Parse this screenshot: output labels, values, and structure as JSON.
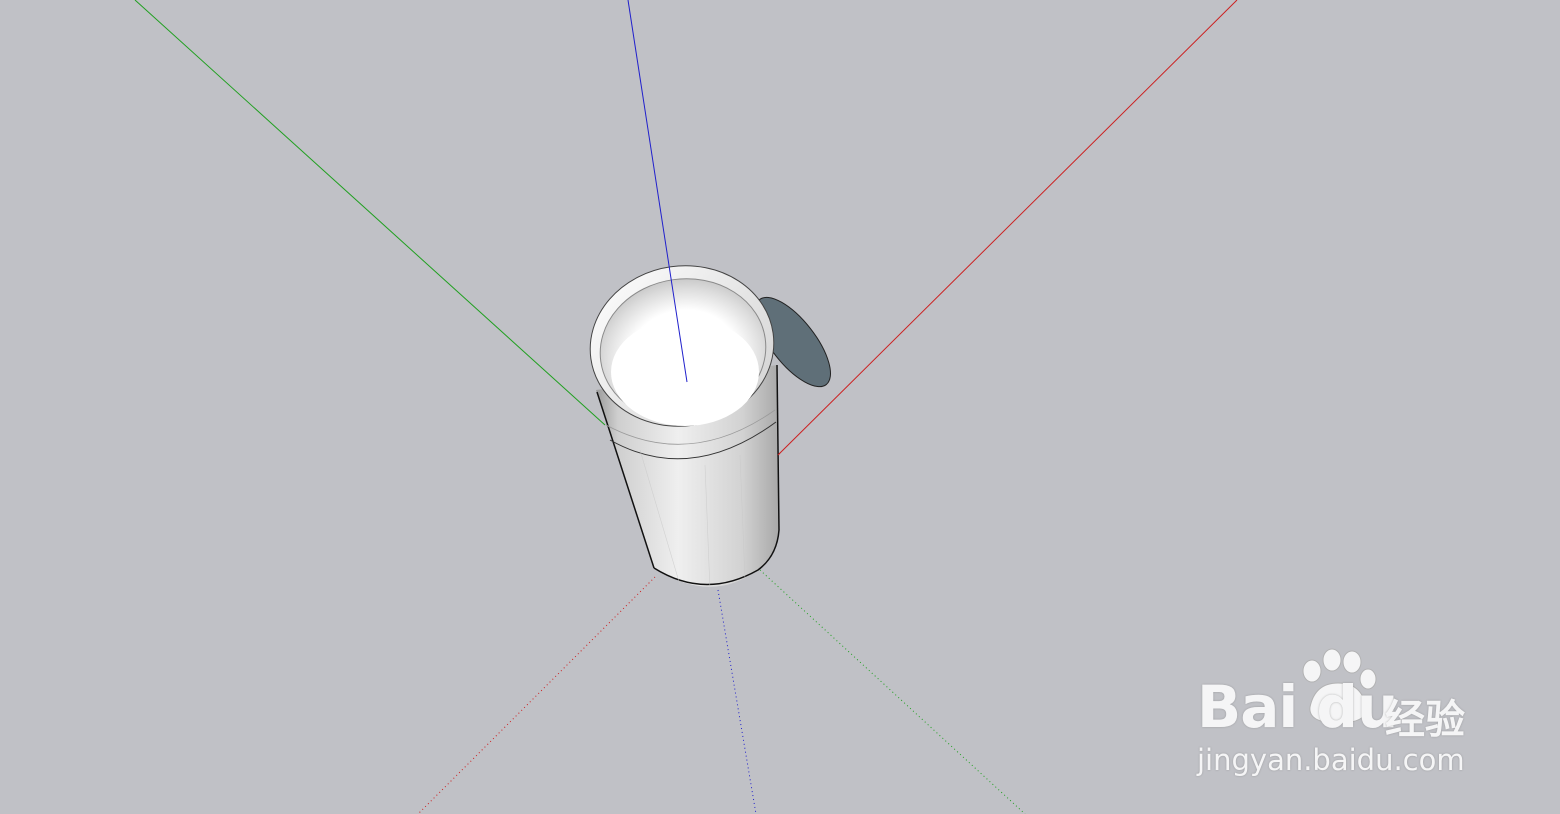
{
  "viewport": {
    "background_color": "#c0c1c6"
  },
  "axes": {
    "x_color": "#cc2020",
    "y_color": "#20a020",
    "z_color": "#2020cc"
  },
  "model": {
    "name": "cylinder-cup",
    "body_color": "#d6d6d6",
    "shadow_color": "#5f6f78",
    "inner_bottom_color": "#ffffff"
  },
  "watermark": {
    "brand": "Bai du",
    "brand_cn": "经验",
    "url": "jingyan.baidu.com"
  }
}
